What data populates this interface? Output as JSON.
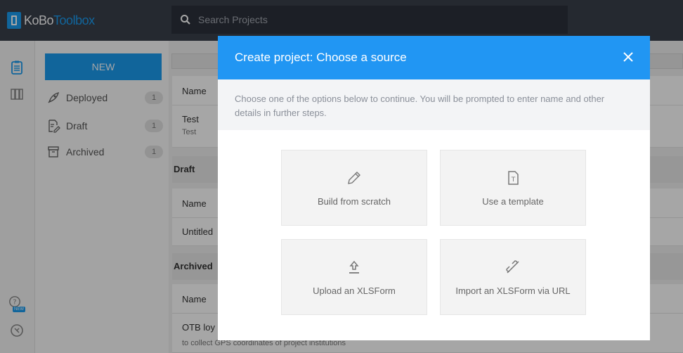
{
  "app": {
    "logo_part1": "KoBo",
    "logo_part2": "Toolbox"
  },
  "search": {
    "placeholder": "Search Projects"
  },
  "sidebar": {
    "new_label": "NEW",
    "items": [
      {
        "label": "Deployed",
        "count": "1"
      },
      {
        "label": "Draft",
        "count": "1"
      },
      {
        "label": "Archived",
        "count": "1"
      }
    ]
  },
  "projects": {
    "col_name": "Name",
    "deployed_row": {
      "title": "Test",
      "desc": "Test"
    },
    "draft_section": "Draft",
    "draft_row": {
      "title": "Untitled"
    },
    "archived_section": "Archived",
    "archived_row": {
      "title": "OTB loy",
      "desc": "to collect GPS coordinates of project institutions"
    }
  },
  "modal": {
    "title": "Create project: Choose a source",
    "description": "Choose one of the options below to continue. You will be prompted to enter name and other details in further steps.",
    "options": [
      {
        "label": "Build from scratch",
        "icon": "pencil-icon"
      },
      {
        "label": "Use a template",
        "icon": "template-icon"
      },
      {
        "label": "Upload an XLSForm",
        "icon": "upload-icon"
      },
      {
        "label": "Import an XLSForm via URL",
        "icon": "link-icon"
      }
    ]
  },
  "rail": {
    "new_badge": "NEW"
  },
  "colors": {
    "accent": "#2196f3",
    "header": "#3a3f4b"
  }
}
